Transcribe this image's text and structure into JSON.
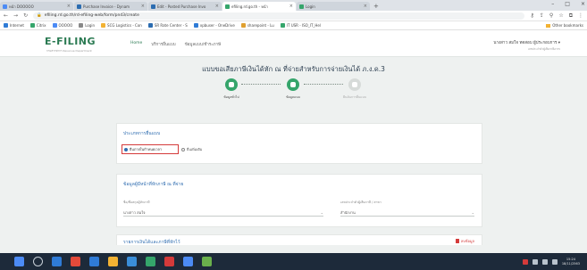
{
  "browser": {
    "tabs": [
      {
        "title": "หน้า DOOOOO",
        "color": "#4c8bf5",
        "active": false
      },
      {
        "title": "Purchase Invoice - Dynam",
        "color": "#2b6cb0",
        "active": false
      },
      {
        "title": "Edit - Posted Purchase Invo",
        "color": "#2b6cb0",
        "active": false
      },
      {
        "title": "efiling.rd.go.th - หน้า",
        "color": "#35a56b",
        "active": true
      },
      {
        "title": "Login",
        "color": "#35a56b",
        "active": false
      }
    ],
    "new_tab": "+",
    "url": "efiling.rd.go.th/rd-efiling-web/form/pnd3/create",
    "bookmarks": [
      "Internet",
      "Citrix",
      "OOOOO",
      "Login",
      "SCG Logistics - Con",
      "SR Rate Center - S",
      "xpbuser - OneDrive",
      "sharepoint - Lu",
      "IT USR - ISO_IT_Hel"
    ],
    "bookmarks_right": "Other bookmarks"
  },
  "site": {
    "logo": "E-FILING",
    "logo_sub": "กรมสรรพากร Revenue Department",
    "menu": [
      "Home",
      "บริการยื่นแบบ",
      "ข้อมูลแบบ/ชำระภาษี"
    ],
    "active_menu_index": 0,
    "user_name": "นางสาว สมใจ ทดสอบ ผู้ประกอบการ",
    "user_sub": "เลขประจำตัวผู้เสียภาษีอากร"
  },
  "page": {
    "title": "แบบขอเสียภาษีเงินได้หัก ณ ที่จ่ายสำหรับการจ่ายเงินได้ ภ.ง.ด.3",
    "steps": [
      {
        "label": "ข้อมูลทั่วไป",
        "state": "done"
      },
      {
        "label": "ข้อมูลแนบ",
        "state": "done"
      },
      {
        "label": "ยืนยันการยื่นแบบ",
        "state": "off"
      }
    ]
  },
  "filing_type": {
    "title": "ประเภทการยื่นแบบ",
    "selected": "ยื่นภายในกำหนดเวลา",
    "other": "ยื่นเพิ่มเติม"
  },
  "payer": {
    "title": "ข้อมูลผู้มีหน้าที่หักภาษี ณ ที่จ่าย",
    "field1_label": "ชื่อ/ชื่อสกุลผู้หักภาษี",
    "field1_value": "นางสาว สมใจ",
    "field2_label": "เลขประจำตัวผู้เสียภาษี / สาขา",
    "field2_value": "สำนักงาน"
  },
  "payee": {
    "title": "รายการเงินได้และภาษีที่หักไว้",
    "delete": "ลบข้อมูล"
  },
  "taskbar": {
    "apps": [
      "#2f7bd6",
      "#e34a3a",
      "#2f7bd6",
      "#f2b233",
      "#3a8ed9",
      "#35a56b",
      "#d43a3a",
      "#4c8bf5",
      "#6ab04c"
    ],
    "time": "15:24",
    "date": "18/11/2563"
  }
}
